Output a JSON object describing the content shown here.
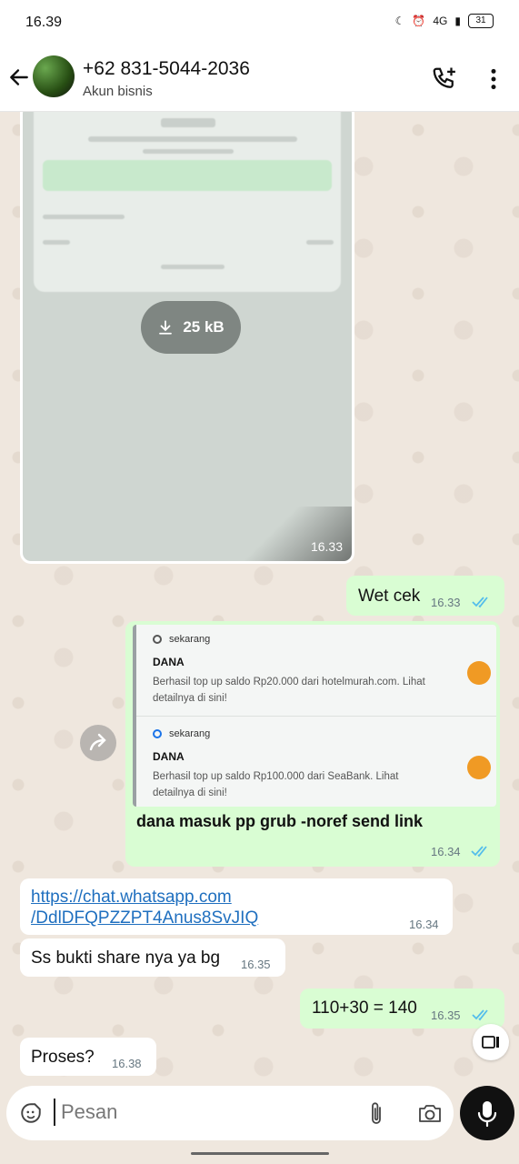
{
  "status": {
    "time": "16.39",
    "network": "4G",
    "battery": "31"
  },
  "header": {
    "contact": "+62 831-5044-2036",
    "subtitle": "Akun bisnis"
  },
  "image_message": {
    "size_label": "25 kB",
    "time": "16.33"
  },
  "messages": [
    {
      "dir": "out",
      "text": "Wet cek",
      "time": "16.33",
      "read": true
    },
    {
      "dir": "out",
      "caption": "dana masuk pp grub -noref send link",
      "time": "16.34",
      "read": true
    },
    {
      "dir": "in",
      "link_line1": "https://chat.whatsapp.com",
      "link_line2": "/DdlDFQPZZPT4Anus8SvJIQ",
      "time": "16.34"
    },
    {
      "dir": "in",
      "text": "Ss bukti share nya ya bg",
      "time": "16.35"
    },
    {
      "dir": "out",
      "text": "110+30 = 140",
      "time": "16.35",
      "read": true
    },
    {
      "dir": "in",
      "text": "Proses?",
      "time": "16.38"
    }
  ],
  "notifications": [
    {
      "source": "sekarang",
      "title": "DANA",
      "body": "Berhasil top up saldo Rp20.000 dari hotelmurah.com. Lihat detailnya di sini!"
    },
    {
      "source": "sekarang",
      "title": "DANA",
      "body": "Berhasil top up saldo Rp100.000 dari SeaBank. Lihat detailnya di sini!"
    }
  ],
  "input": {
    "placeholder": "Pesan"
  },
  "colors": {
    "outgoing": "#d9fdd3",
    "incoming": "#ffffff",
    "read_ticks": "#53bdeb",
    "wallpaper": "#efe7de"
  }
}
